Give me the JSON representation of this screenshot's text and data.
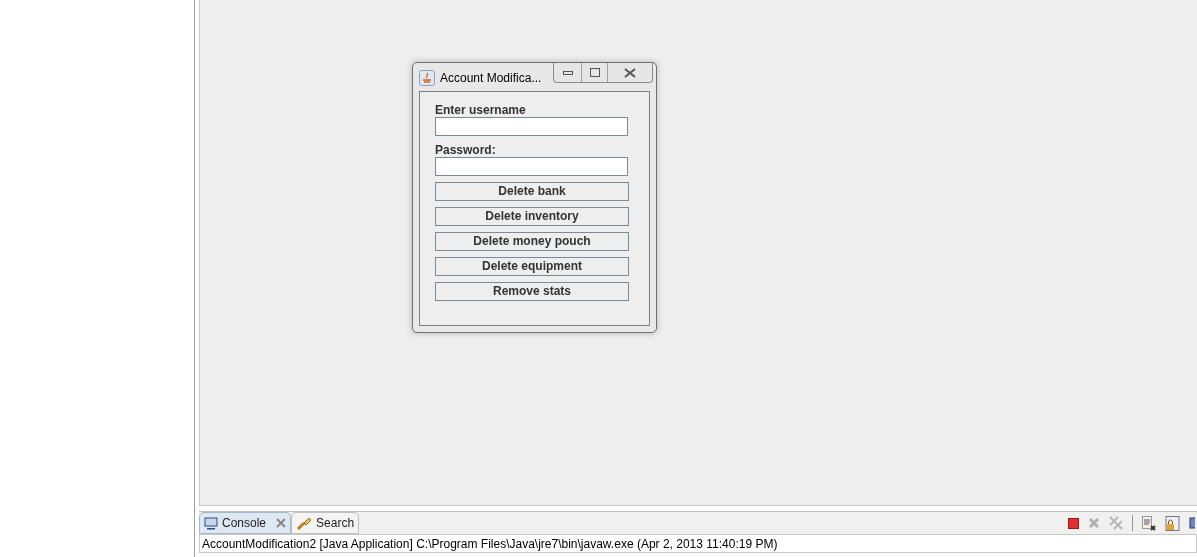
{
  "dialog": {
    "title": "Account Modifica...",
    "username_label": "Enter username",
    "password_label": "Password:",
    "buttons": [
      "Delete bank",
      "Delete inventory",
      "Delete money pouch",
      "Delete equipment",
      "Remove stats"
    ]
  },
  "console": {
    "tabs": [
      {
        "label": "Console",
        "selected": true
      },
      {
        "label": "Search",
        "selected": false
      }
    ],
    "status": "AccountModification2 [Java Application] C:\\Program Files\\Java\\jre7\\bin\\javaw.exe (Apr 2, 2013 11:40:19 PM)"
  }
}
